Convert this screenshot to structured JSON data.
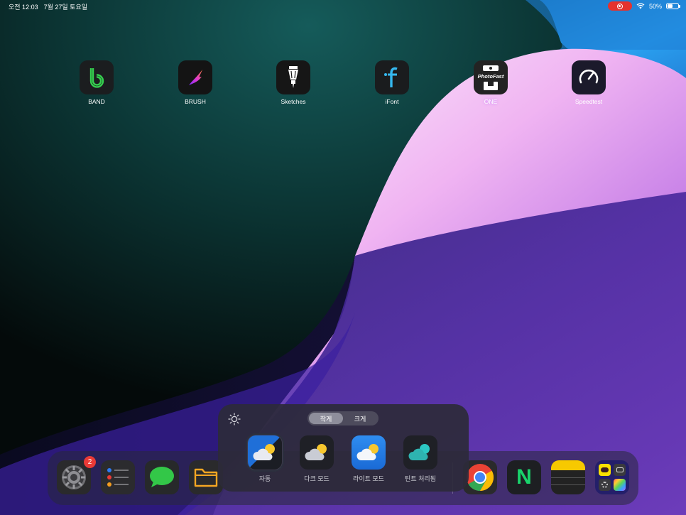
{
  "status_bar": {
    "time": "오전 12:03",
    "date": "7월 27일 토요일",
    "battery": "50%",
    "battery_level": 0.5
  },
  "home_apps": [
    {
      "label": "BAND",
      "icon": "band-icon"
    },
    {
      "label": "BRUSH",
      "icon": "brush-icon"
    },
    {
      "label": "Sketches",
      "icon": "sketches-icon"
    },
    {
      "label": "iFont",
      "icon": "ifont-icon"
    },
    {
      "label": "ONE",
      "icon": "photofast-one-icon",
      "icon_text": "PhotoFast"
    },
    {
      "label": "Speedtest",
      "icon": "speedtest-icon"
    }
  ],
  "dock": {
    "settings_badge": "2",
    "apps": [
      "settings-icon",
      "reminders-icon",
      "messages-icon",
      "files-icon",
      "chrome-icon",
      "naver-icon",
      "notes-icon",
      "app-library-icon"
    ],
    "naver_letter": "N"
  },
  "popup": {
    "size_options": [
      "작게",
      "크게"
    ],
    "selected_size": "작게",
    "styles": [
      {
        "label": "자동",
        "icon": "weather-auto-icon"
      },
      {
        "label": "다크 모드",
        "icon": "weather-dark-icon"
      },
      {
        "label": "라이트 모드",
        "icon": "weather-light-icon"
      },
      {
        "label": "틴트 처리됨",
        "icon": "weather-tinted-icon"
      }
    ],
    "selected_style": "자동"
  },
  "colors": {
    "record_indicator": "#e5322d",
    "badge": "#ea3a36",
    "wallpaper_teal": "#0e4a4a",
    "wallpaper_pink": "#f1a8f0",
    "wallpaper_purple": "#4b2aa0",
    "wallpaper_blue": "#2b8fe0"
  }
}
